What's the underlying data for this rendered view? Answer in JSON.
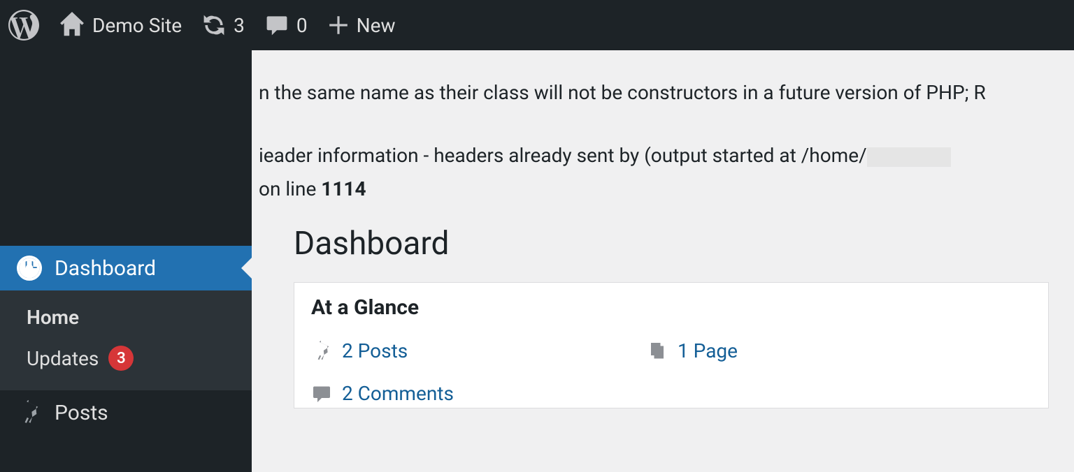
{
  "adminbar": {
    "site_name": "Demo Site",
    "refresh_count": "3",
    "comment_count": "0",
    "new_label": "New"
  },
  "sidebar": {
    "dashboard_label": "Dashboard",
    "home_label": "Home",
    "updates_label": "Updates",
    "updates_count": "3",
    "posts_label": "Posts"
  },
  "warnings": {
    "line1": "n the same name as their class will not be constructors in a future version of PHP; R",
    "line2_a": "ieader information - headers already sent by (output started at /home/",
    "line3_a": "on line ",
    "line3_b": "1114"
  },
  "page": {
    "title": "Dashboard",
    "glance": {
      "title": "At a Glance",
      "posts": "2 Posts",
      "pages": "1 Page",
      "comments": "2 Comments"
    }
  }
}
